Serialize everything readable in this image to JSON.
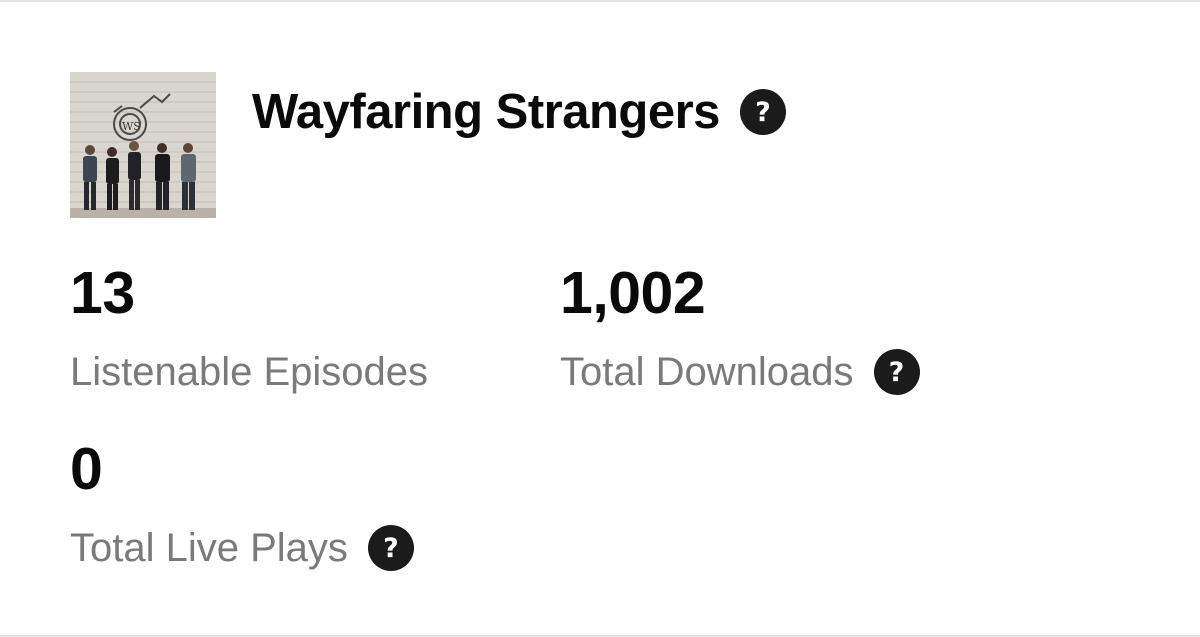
{
  "podcast": {
    "title": "Wayfaring Strangers",
    "cover_alt": "Wayfaring Strangers band photo"
  },
  "stats": {
    "episodes": {
      "value": "13",
      "label": "Listenable Episodes"
    },
    "downloads": {
      "value": "1,002",
      "label": "Total Downloads"
    },
    "live_plays": {
      "value": "0",
      "label": "Total Live Plays"
    }
  },
  "icons": {
    "help": "question-mark-circle-icon",
    "help_glyph": "?"
  },
  "colors": {
    "text_primary": "#0a0a0a",
    "text_secondary": "#7a7a7a",
    "help_icon_bg": "#1b1b1b",
    "divider": "#e4e4e4"
  }
}
